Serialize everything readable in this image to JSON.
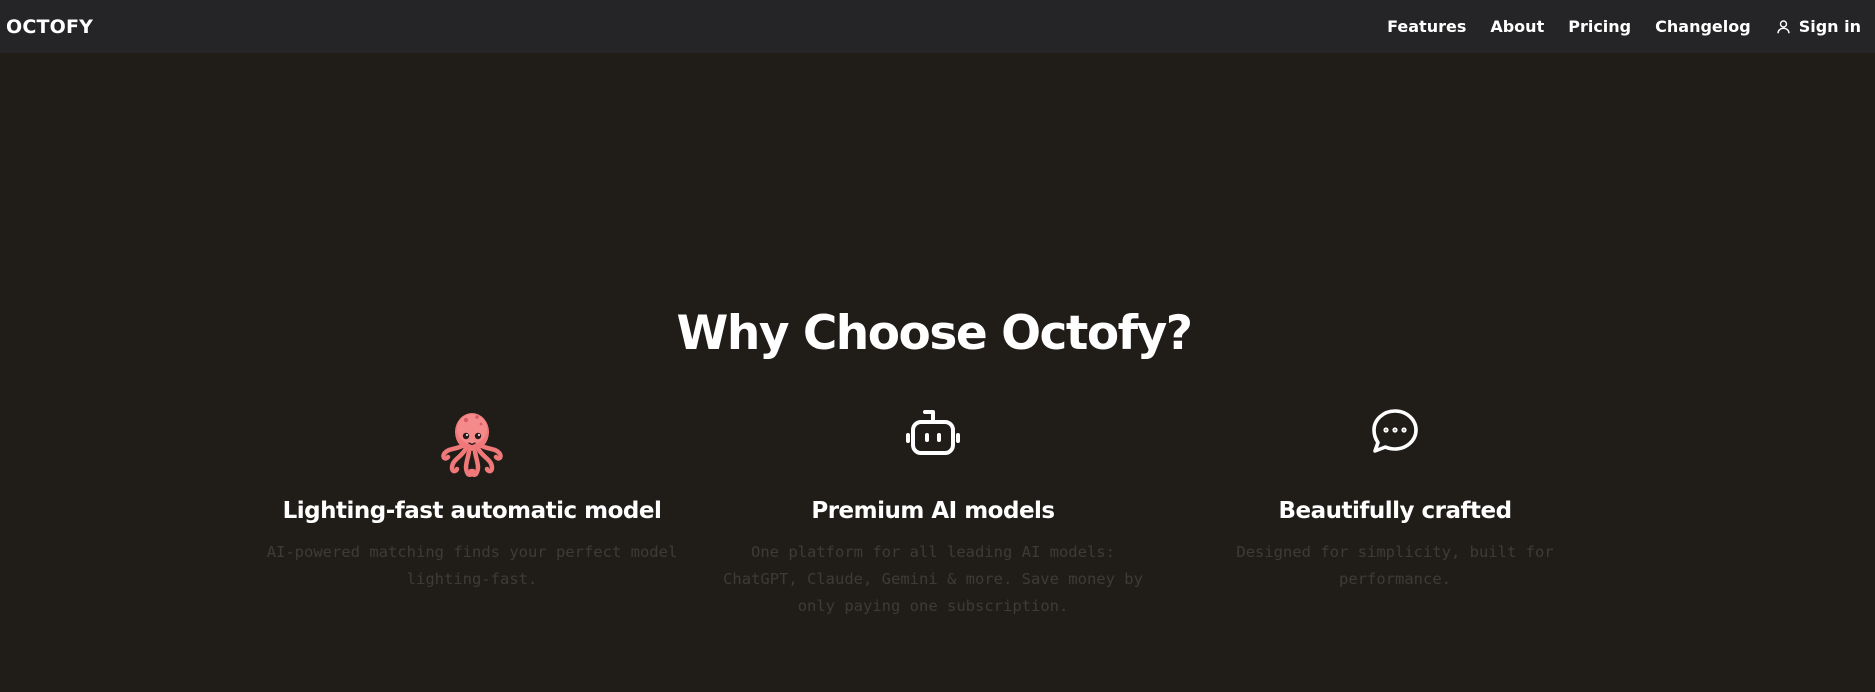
{
  "header": {
    "brand": "OCTOFY",
    "nav": [
      {
        "label": "Features"
      },
      {
        "label": "About"
      },
      {
        "label": "Pricing"
      },
      {
        "label": "Changelog"
      }
    ],
    "signin_label": "Sign in",
    "signin_icon": "user-icon"
  },
  "main": {
    "headline": "Why Choose Octofy?",
    "features": [
      {
        "icon": "octopus-icon",
        "title": "Lighting-fast automatic model",
        "description": "AI-powered matching finds your perfect model lighting-fast."
      },
      {
        "icon": "robot-icon",
        "title": "Premium AI models",
        "description": "One platform for all leading AI models: ChatGPT, Claude, Gemini & more. Save money by only paying one subscription."
      },
      {
        "icon": "chat-bubble-icon",
        "title": "Beautifully crafted",
        "description": "Designed for simplicity, built for performance."
      }
    ]
  },
  "colors": {
    "background": "#201d19",
    "navbar": "#252527",
    "text": "#ffffff",
    "muted_text": "#3e3b37",
    "octopus": "#f07878"
  }
}
